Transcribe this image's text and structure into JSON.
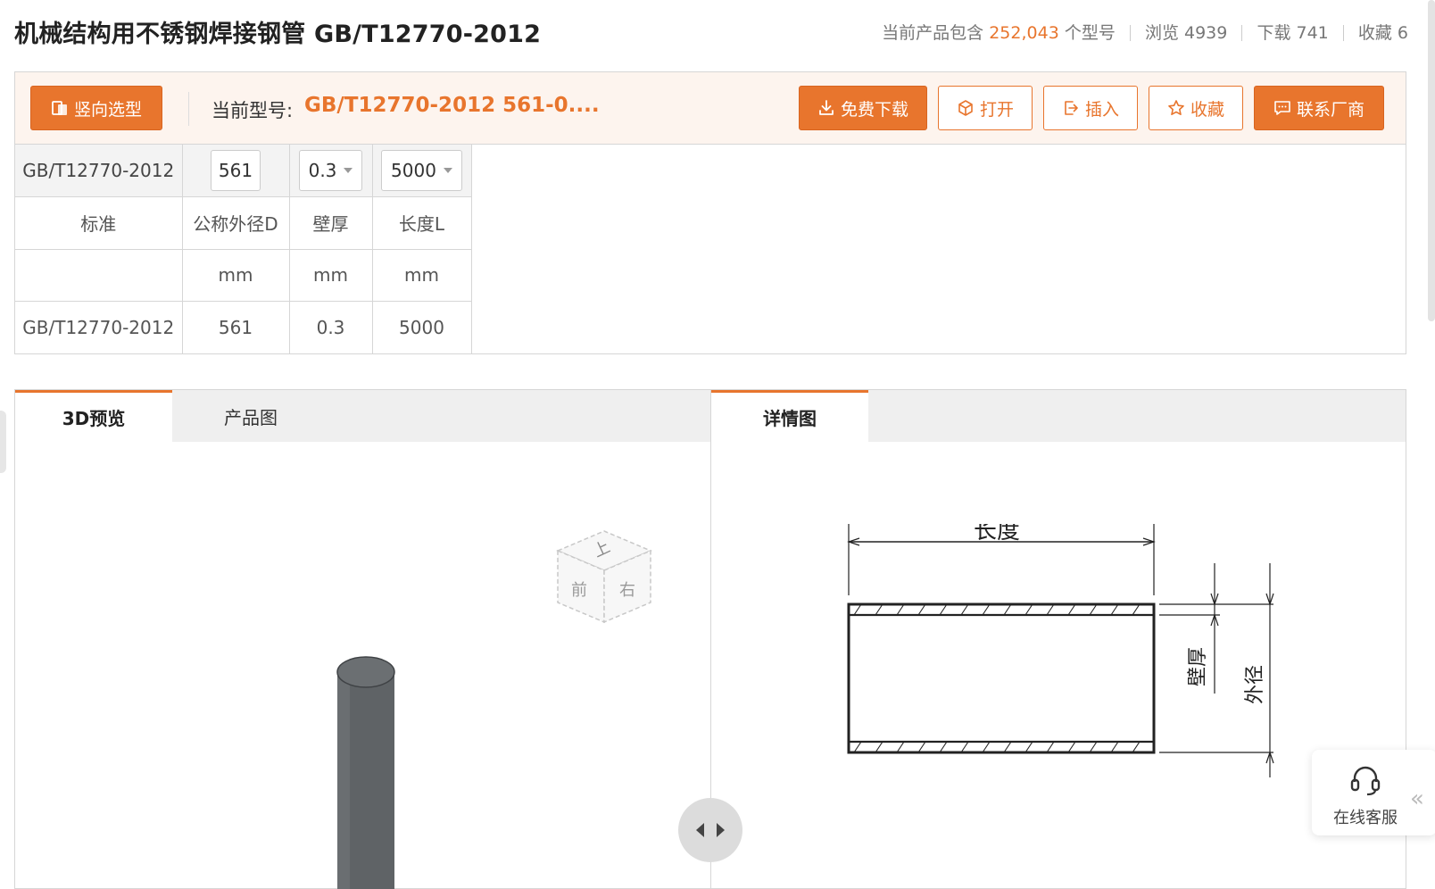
{
  "header": {
    "title": "机械结构用不锈钢焊接钢管 GB/T12770-2012",
    "stats": {
      "prefix": "当前产品包含",
      "model_count": "252,043",
      "model_unit": "个型号",
      "views_label": "浏览 4939",
      "downloads_label": "下载 741",
      "favorites_label": "收藏 6"
    }
  },
  "toolbar": {
    "vertical_select": "竖向选型",
    "current_label": "当前型号:",
    "current_value": "GB/T12770-2012 561-0....",
    "download": "免费下载",
    "open": "打开",
    "insert": "插入",
    "favorite": "收藏",
    "contact": "联系厂商"
  },
  "spec": {
    "standard_value": "GB/T12770-2012",
    "d_input": "561",
    "thickness_select": "0.3",
    "length_select": "5000",
    "headers": [
      "标准",
      "公称外径D",
      "壁厚",
      "长度L"
    ],
    "units": [
      "",
      "mm",
      "mm",
      "mm"
    ],
    "row": [
      "GB/T12770-2012",
      "561",
      "0.3",
      "5000"
    ]
  },
  "left_panel": {
    "tab_3d": "3D预览",
    "tab_product": "产品图",
    "cube_top": "上",
    "cube_front": "前",
    "cube_right": "右"
  },
  "right_panel": {
    "tab_detail": "详情图",
    "dim_length": "长度",
    "dim_thickness": "壁厚",
    "dim_outer": "外径"
  },
  "service": {
    "label": "在线客服"
  },
  "colors": {
    "accent": "#e8752d",
    "toolbar_bg": "#fdf4ee",
    "border": "#d6d6d6",
    "cylinder": "#5f6366"
  }
}
